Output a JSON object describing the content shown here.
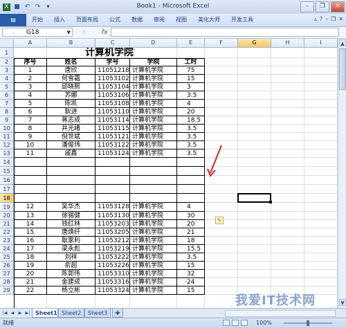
{
  "window": {
    "title": "Book1 - Microsoft Excel"
  },
  "ribbon": {
    "tabs": [
      "开始",
      "插入",
      "页面布局",
      "公式",
      "数据",
      "审阅",
      "视图",
      "美化大师",
      "开发工具"
    ]
  },
  "formula_bar": {
    "name_box": "G18",
    "fx": "fx",
    "formula": ""
  },
  "columns": [
    "A",
    "B",
    "C",
    "D",
    "E",
    "F",
    "G",
    "H",
    "I"
  ],
  "rows": [
    "1",
    "2",
    "3",
    "4",
    "5",
    "6",
    "7",
    "8",
    "9",
    "10",
    "11",
    "12",
    "13",
    "14",
    "15",
    "16",
    "17",
    "18",
    "19",
    "20",
    "21",
    "22",
    "23",
    "24",
    "25",
    "26",
    "27",
    "28",
    "29"
  ],
  "sheet": {
    "title": "计算机学院",
    "headers": [
      "序号",
      "姓名",
      "学号",
      "学院",
      "工时"
    ],
    "top_rows": [
      [
        "1",
        "唐欣",
        "11051218",
        "计算机学院",
        "75"
      ],
      [
        "2",
        "何雪霜",
        "11053102",
        "计算机学院",
        "15"
      ],
      [
        "3",
        "邱晓熙",
        "11053104",
        "计算机学院",
        "3"
      ],
      [
        "4",
        "苏娜",
        "11053106",
        "计算机学院",
        "3.5"
      ],
      [
        "5",
        "陈凯",
        "11053108",
        "计算机学院",
        "4"
      ],
      [
        "6",
        "耿进",
        "11053110",
        "计算机学院",
        "20"
      ],
      [
        "7",
        "蒋志成",
        "11053114",
        "计算机学院",
        "18.5"
      ],
      [
        "8",
        "井光绪",
        "11053115",
        "计算机学院",
        "3.5"
      ],
      [
        "9",
        "倪世斌",
        "11053121",
        "计算机学院",
        "3.5"
      ],
      [
        "10",
        "潘俊玮",
        "11053122",
        "计算机学院",
        "3.5"
      ],
      [
        "11",
        "戚鑫",
        "11053124",
        "计算机学院",
        "3.5"
      ]
    ],
    "bottom_rows": [
      [
        "12",
        "吴华杰",
        "11053128",
        "计算机学院",
        "4"
      ],
      [
        "13",
        "徐锡健",
        "11053130",
        "计算机学院",
        "30"
      ],
      [
        "14",
        "钱红林",
        "11053203",
        "计算机学院",
        "20"
      ],
      [
        "15",
        "唐焕纤",
        "11053205",
        "计算机学院",
        "21"
      ],
      [
        "16",
        "耿家利",
        "11053212",
        "计算机学院",
        "18"
      ],
      [
        "17",
        "梁永彪",
        "11053219",
        "计算机学院",
        "15.5"
      ],
      [
        "18",
        "刘祥",
        "11053222",
        "计算机学院",
        "3.5"
      ],
      [
        "19",
        "俞超",
        "11053226",
        "计算机学院",
        "15"
      ],
      [
        "20",
        "陈郭伟",
        "11053310",
        "计算机学院",
        "32"
      ],
      [
        "21",
        "金建成",
        "11053316",
        "计算机学院",
        "24"
      ],
      [
        "22",
        "杨立彬",
        "11053324",
        "计算机学院",
        "15"
      ]
    ]
  },
  "sheet_tabs": [
    "Sheet1",
    "Sheet2",
    "Sheet3"
  ],
  "status": {
    "ready": "就绪",
    "zoom": "100%"
  },
  "watermark": "我爱IT技术网",
  "colors": {
    "arrow": "#e02020",
    "selected_header": "#f4c865"
  }
}
